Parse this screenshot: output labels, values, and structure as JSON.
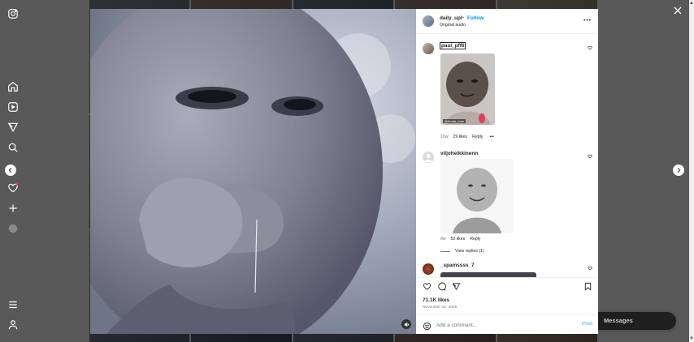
{
  "post": {
    "author": "daily_upl",
    "separator": "•",
    "follow_label": "Follow",
    "audio": "Original audio",
    "likes": "71.1K likes",
    "date": "November 24, 2025"
  },
  "comments": [
    {
      "username": "paul_pff6",
      "gif_caption": "@beata_man",
      "age": "10w",
      "likes": "29 likes",
      "reply": "Reply"
    },
    {
      "username": "viljoheikkinenn",
      "age": "8w",
      "likes": "52 likes",
      "reply": "Reply",
      "view_replies": "View replies (1)"
    },
    {
      "username": "_spamssss_7"
    }
  ],
  "composer": {
    "placeholder": "Add a comment...",
    "post_label": "Post"
  },
  "messages": {
    "label": "Messages"
  },
  "colors": {
    "accent": "#0095f6",
    "text": "#262626",
    "muted": "#737373"
  }
}
